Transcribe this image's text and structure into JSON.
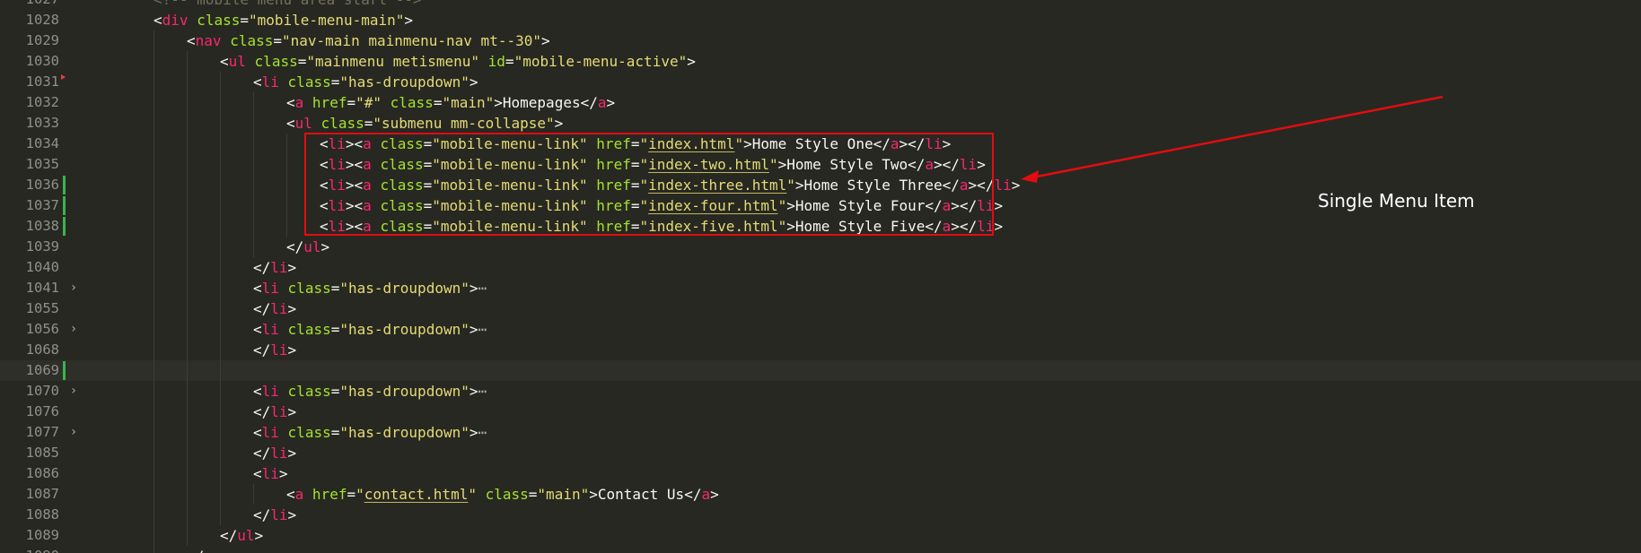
{
  "annotation": {
    "label": "Single Menu Item",
    "color": "#e10d11"
  },
  "colors": {
    "background": "#272822",
    "tag": "#f92672",
    "attribute": "#a6e22e",
    "string": "#e6db74",
    "text": "#f8f8f2",
    "line_number": "#8f908a",
    "git_modified": "#39b54a"
  },
  "fold_icon": "chevron-right-icon",
  "fold_placeholder": "⋯",
  "lines": [
    {
      "num": "1027",
      "indent": 2,
      "tokens": [
        {
          "t": "com",
          "v": "<!-- mobile menu area start -->"
        }
      ]
    },
    {
      "num": "1028",
      "indent": 2,
      "tokens": [
        {
          "t": "punc",
          "v": "<"
        },
        {
          "t": "tag",
          "v": "div"
        },
        {
          "t": "punc",
          "v": " "
        },
        {
          "t": "attr",
          "v": "class"
        },
        {
          "t": "punc",
          "v": "="
        },
        {
          "t": "str",
          "v": "\"mobile-menu-main\""
        },
        {
          "t": "punc",
          "v": ">"
        }
      ]
    },
    {
      "num": "1029",
      "indent": 3,
      "tokens": [
        {
          "t": "punc",
          "v": "<"
        },
        {
          "t": "tag",
          "v": "nav"
        },
        {
          "t": "punc",
          "v": " "
        },
        {
          "t": "attr",
          "v": "class"
        },
        {
          "t": "punc",
          "v": "="
        },
        {
          "t": "str",
          "v": "\"nav-main mainmenu-nav mt--30\""
        },
        {
          "t": "punc",
          "v": ">"
        }
      ]
    },
    {
      "num": "1030",
      "indent": 4,
      "tokens": [
        {
          "t": "punc",
          "v": "<"
        },
        {
          "t": "tag",
          "v": "ul"
        },
        {
          "t": "punc",
          "v": " "
        },
        {
          "t": "attr",
          "v": "class"
        },
        {
          "t": "punc",
          "v": "="
        },
        {
          "t": "str",
          "v": "\"mainmenu metismenu\""
        },
        {
          "t": "punc",
          "v": " "
        },
        {
          "t": "attr",
          "v": "id"
        },
        {
          "t": "punc",
          "v": "="
        },
        {
          "t": "str",
          "v": "\"mobile-menu-active\""
        },
        {
          "t": "punc",
          "v": ">"
        }
      ]
    },
    {
      "num": "1031",
      "indent": 5,
      "mark": "red",
      "tokens": [
        {
          "t": "punc",
          "v": "<"
        },
        {
          "t": "tag",
          "v": "li"
        },
        {
          "t": "punc",
          "v": " "
        },
        {
          "t": "attr",
          "v": "class"
        },
        {
          "t": "punc",
          "v": "="
        },
        {
          "t": "str",
          "v": "\"has-droupdown\""
        },
        {
          "t": "punc",
          "v": ">"
        }
      ]
    },
    {
      "num": "1032",
      "indent": 6,
      "tokens": [
        {
          "t": "punc",
          "v": "<"
        },
        {
          "t": "tag",
          "v": "a"
        },
        {
          "t": "punc",
          "v": " "
        },
        {
          "t": "attr",
          "v": "href"
        },
        {
          "t": "punc",
          "v": "="
        },
        {
          "t": "str",
          "v": "\"#\""
        },
        {
          "t": "punc",
          "v": " "
        },
        {
          "t": "attr",
          "v": "class"
        },
        {
          "t": "punc",
          "v": "="
        },
        {
          "t": "str",
          "v": "\"main\""
        },
        {
          "t": "punc",
          "v": ">"
        },
        {
          "t": "text",
          "v": "Homepages"
        },
        {
          "t": "punc",
          "v": "</"
        },
        {
          "t": "tag",
          "v": "a"
        },
        {
          "t": "punc",
          "v": ">"
        }
      ]
    },
    {
      "num": "1033",
      "indent": 6,
      "tokens": [
        {
          "t": "punc",
          "v": "<"
        },
        {
          "t": "tag",
          "v": "ul"
        },
        {
          "t": "punc",
          "v": " "
        },
        {
          "t": "attr",
          "v": "class"
        },
        {
          "t": "punc",
          "v": "="
        },
        {
          "t": "str",
          "v": "\"submenu mm-collapse\""
        },
        {
          "t": "punc",
          "v": ">"
        }
      ]
    },
    {
      "num": "1034",
      "indent": 7,
      "tokens": [
        {
          "t": "punc",
          "v": "<"
        },
        {
          "t": "tag",
          "v": "li"
        },
        {
          "t": "punc",
          "v": "><"
        },
        {
          "t": "tag",
          "v": "a"
        },
        {
          "t": "punc",
          "v": " "
        },
        {
          "t": "attr",
          "v": "class"
        },
        {
          "t": "punc",
          "v": "="
        },
        {
          "t": "str",
          "v": "\"mobile-menu-link\""
        },
        {
          "t": "punc",
          "v": " "
        },
        {
          "t": "attr",
          "v": "href"
        },
        {
          "t": "punc",
          "v": "="
        },
        {
          "t": "str",
          "v": "\""
        },
        {
          "t": "link",
          "v": "index.html"
        },
        {
          "t": "str",
          "v": "\""
        },
        {
          "t": "punc",
          "v": ">"
        },
        {
          "t": "text",
          "v": "Home Style One"
        },
        {
          "t": "punc",
          "v": "</"
        },
        {
          "t": "tag",
          "v": "a"
        },
        {
          "t": "punc",
          "v": "></"
        },
        {
          "t": "tag",
          "v": "li"
        },
        {
          "t": "punc",
          "v": ">"
        }
      ]
    },
    {
      "num": "1035",
      "indent": 7,
      "tokens": [
        {
          "t": "punc",
          "v": "<"
        },
        {
          "t": "tag",
          "v": "li"
        },
        {
          "t": "punc",
          "v": "><"
        },
        {
          "t": "tag",
          "v": "a"
        },
        {
          "t": "punc",
          "v": " "
        },
        {
          "t": "attr",
          "v": "class"
        },
        {
          "t": "punc",
          "v": "="
        },
        {
          "t": "str",
          "v": "\"mobile-menu-link\""
        },
        {
          "t": "punc",
          "v": " "
        },
        {
          "t": "attr",
          "v": "href"
        },
        {
          "t": "punc",
          "v": "="
        },
        {
          "t": "str",
          "v": "\""
        },
        {
          "t": "link",
          "v": "index-two.html"
        },
        {
          "t": "str",
          "v": "\""
        },
        {
          "t": "punc",
          "v": ">"
        },
        {
          "t": "text",
          "v": "Home Style Two"
        },
        {
          "t": "punc",
          "v": "</"
        },
        {
          "t": "tag",
          "v": "a"
        },
        {
          "t": "punc",
          "v": "></"
        },
        {
          "t": "tag",
          "v": "li"
        },
        {
          "t": "punc",
          "v": ">"
        }
      ]
    },
    {
      "num": "1036",
      "indent": 7,
      "mark": "git",
      "tokens": [
        {
          "t": "punc",
          "v": "<"
        },
        {
          "t": "tag",
          "v": "li"
        },
        {
          "t": "punc",
          "v": "><"
        },
        {
          "t": "tag",
          "v": "a"
        },
        {
          "t": "punc",
          "v": " "
        },
        {
          "t": "attr",
          "v": "class"
        },
        {
          "t": "punc",
          "v": "="
        },
        {
          "t": "str",
          "v": "\"mobile-menu-link\""
        },
        {
          "t": "punc",
          "v": " "
        },
        {
          "t": "attr",
          "v": "href"
        },
        {
          "t": "punc",
          "v": "="
        },
        {
          "t": "str",
          "v": "\""
        },
        {
          "t": "link",
          "v": "index-three.html"
        },
        {
          "t": "str",
          "v": "\""
        },
        {
          "t": "punc",
          "v": ">"
        },
        {
          "t": "text",
          "v": "Home Style Three"
        },
        {
          "t": "punc",
          "v": "</"
        },
        {
          "t": "tag",
          "v": "a"
        },
        {
          "t": "punc",
          "v": "></"
        },
        {
          "t": "tag",
          "v": "li"
        },
        {
          "t": "punc",
          "v": ">"
        }
      ]
    },
    {
      "num": "1037",
      "indent": 7,
      "mark": "git",
      "tokens": [
        {
          "t": "punc",
          "v": "<"
        },
        {
          "t": "tag",
          "v": "li"
        },
        {
          "t": "punc",
          "v": "><"
        },
        {
          "t": "tag",
          "v": "a"
        },
        {
          "t": "punc",
          "v": " "
        },
        {
          "t": "attr",
          "v": "class"
        },
        {
          "t": "punc",
          "v": "="
        },
        {
          "t": "str",
          "v": "\"mobile-menu-link\""
        },
        {
          "t": "punc",
          "v": " "
        },
        {
          "t": "attr",
          "v": "href"
        },
        {
          "t": "punc",
          "v": "="
        },
        {
          "t": "str",
          "v": "\""
        },
        {
          "t": "link",
          "v": "index-four.html"
        },
        {
          "t": "str",
          "v": "\""
        },
        {
          "t": "punc",
          "v": ">"
        },
        {
          "t": "text",
          "v": "Home Style Four"
        },
        {
          "t": "punc",
          "v": "</"
        },
        {
          "t": "tag",
          "v": "a"
        },
        {
          "t": "punc",
          "v": "></"
        },
        {
          "t": "tag",
          "v": "li"
        },
        {
          "t": "punc",
          "v": ">"
        }
      ]
    },
    {
      "num": "1038",
      "indent": 7,
      "mark": "git",
      "tokens": [
        {
          "t": "punc",
          "v": "<"
        },
        {
          "t": "tag",
          "v": "li"
        },
        {
          "t": "punc",
          "v": "><"
        },
        {
          "t": "tag",
          "v": "a"
        },
        {
          "t": "punc",
          "v": " "
        },
        {
          "t": "attr",
          "v": "class"
        },
        {
          "t": "punc",
          "v": "="
        },
        {
          "t": "str",
          "v": "\"mobile-menu-link\""
        },
        {
          "t": "punc",
          "v": " "
        },
        {
          "t": "attr",
          "v": "href"
        },
        {
          "t": "punc",
          "v": "="
        },
        {
          "t": "str",
          "v": "\""
        },
        {
          "t": "link",
          "v": "index-five.html"
        },
        {
          "t": "str",
          "v": "\""
        },
        {
          "t": "punc",
          "v": ">"
        },
        {
          "t": "text",
          "v": "Home Style Five"
        },
        {
          "t": "punc",
          "v": "</"
        },
        {
          "t": "tag",
          "v": "a"
        },
        {
          "t": "punc",
          "v": "></"
        },
        {
          "t": "tag",
          "v": "li"
        },
        {
          "t": "punc",
          "v": ">"
        }
      ]
    },
    {
      "num": "1039",
      "indent": 6,
      "tokens": [
        {
          "t": "punc",
          "v": "</"
        },
        {
          "t": "tag",
          "v": "ul"
        },
        {
          "t": "punc",
          "v": ">"
        }
      ]
    },
    {
      "num": "1040",
      "indent": 5,
      "tokens": [
        {
          "t": "punc",
          "v": "</"
        },
        {
          "t": "tag",
          "v": "li"
        },
        {
          "t": "punc",
          "v": ">"
        }
      ]
    },
    {
      "num": "1041",
      "indent": 5,
      "fold": true,
      "tokens": [
        {
          "t": "punc",
          "v": "<"
        },
        {
          "t": "tag",
          "v": "li"
        },
        {
          "t": "punc",
          "v": " "
        },
        {
          "t": "attr",
          "v": "class"
        },
        {
          "t": "punc",
          "v": "="
        },
        {
          "t": "str",
          "v": "\"has-droupdown\""
        },
        {
          "t": "punc",
          "v": ">"
        },
        {
          "t": "fold",
          "v": "⋯"
        }
      ]
    },
    {
      "num": "1055",
      "indent": 5,
      "tokens": [
        {
          "t": "punc",
          "v": "</"
        },
        {
          "t": "tag",
          "v": "li"
        },
        {
          "t": "punc",
          "v": ">"
        }
      ]
    },
    {
      "num": "1056",
      "indent": 5,
      "fold": true,
      "tokens": [
        {
          "t": "punc",
          "v": "<"
        },
        {
          "t": "tag",
          "v": "li"
        },
        {
          "t": "punc",
          "v": " "
        },
        {
          "t": "attr",
          "v": "class"
        },
        {
          "t": "punc",
          "v": "="
        },
        {
          "t": "str",
          "v": "\"has-droupdown\""
        },
        {
          "t": "punc",
          "v": ">"
        },
        {
          "t": "fold",
          "v": "⋯"
        }
      ]
    },
    {
      "num": "1068",
      "indent": 5,
      "tokens": [
        {
          "t": "punc",
          "v": "</"
        },
        {
          "t": "tag",
          "v": "li"
        },
        {
          "t": "punc",
          "v": ">"
        }
      ]
    },
    {
      "num": "1069",
      "indent": 5,
      "mark": "git",
      "tokens": []
    },
    {
      "num": "1070",
      "indent": 5,
      "fold": true,
      "tokens": [
        {
          "t": "punc",
          "v": "<"
        },
        {
          "t": "tag",
          "v": "li"
        },
        {
          "t": "punc",
          "v": " "
        },
        {
          "t": "attr",
          "v": "class"
        },
        {
          "t": "punc",
          "v": "="
        },
        {
          "t": "str",
          "v": "\"has-droupdown\""
        },
        {
          "t": "punc",
          "v": ">"
        },
        {
          "t": "fold",
          "v": "⋯"
        }
      ]
    },
    {
      "num": "1076",
      "indent": 5,
      "tokens": [
        {
          "t": "punc",
          "v": "</"
        },
        {
          "t": "tag",
          "v": "li"
        },
        {
          "t": "punc",
          "v": ">"
        }
      ]
    },
    {
      "num": "1077",
      "indent": 5,
      "fold": true,
      "tokens": [
        {
          "t": "punc",
          "v": "<"
        },
        {
          "t": "tag",
          "v": "li"
        },
        {
          "t": "punc",
          "v": " "
        },
        {
          "t": "attr",
          "v": "class"
        },
        {
          "t": "punc",
          "v": "="
        },
        {
          "t": "str",
          "v": "\"has-droupdown\""
        },
        {
          "t": "punc",
          "v": ">"
        },
        {
          "t": "fold",
          "v": "⋯"
        }
      ]
    },
    {
      "num": "1085",
      "indent": 5,
      "tokens": [
        {
          "t": "punc",
          "v": "</"
        },
        {
          "t": "tag",
          "v": "li"
        },
        {
          "t": "punc",
          "v": ">"
        }
      ]
    },
    {
      "num": "1086",
      "indent": 5,
      "tokens": [
        {
          "t": "punc",
          "v": "<"
        },
        {
          "t": "tag",
          "v": "li"
        },
        {
          "t": "punc",
          "v": ">"
        }
      ]
    },
    {
      "num": "1087",
      "indent": 6,
      "tokens": [
        {
          "t": "punc",
          "v": "<"
        },
        {
          "t": "tag",
          "v": "a"
        },
        {
          "t": "punc",
          "v": " "
        },
        {
          "t": "attr",
          "v": "href"
        },
        {
          "t": "punc",
          "v": "="
        },
        {
          "t": "str",
          "v": "\""
        },
        {
          "t": "link",
          "v": "contact.html"
        },
        {
          "t": "str",
          "v": "\""
        },
        {
          "t": "punc",
          "v": " "
        },
        {
          "t": "attr",
          "v": "class"
        },
        {
          "t": "punc",
          "v": "="
        },
        {
          "t": "str",
          "v": "\"main\""
        },
        {
          "t": "punc",
          "v": ">"
        },
        {
          "t": "text",
          "v": "Contact Us"
        },
        {
          "t": "punc",
          "v": "</"
        },
        {
          "t": "tag",
          "v": "a"
        },
        {
          "t": "punc",
          "v": ">"
        }
      ]
    },
    {
      "num": "1088",
      "indent": 5,
      "tokens": [
        {
          "t": "punc",
          "v": "</"
        },
        {
          "t": "tag",
          "v": "li"
        },
        {
          "t": "punc",
          "v": ">"
        }
      ]
    },
    {
      "num": "1089",
      "indent": 4,
      "tokens": [
        {
          "t": "punc",
          "v": "</"
        },
        {
          "t": "tag",
          "v": "ul"
        },
        {
          "t": "punc",
          "v": ">"
        }
      ]
    },
    {
      "num": "1090",
      "indent": 3,
      "tokens": [
        {
          "t": "punc",
          "v": "</"
        },
        {
          "t": "tag",
          "v": "nav"
        },
        {
          "t": "punc",
          "v": ">"
        }
      ]
    }
  ]
}
